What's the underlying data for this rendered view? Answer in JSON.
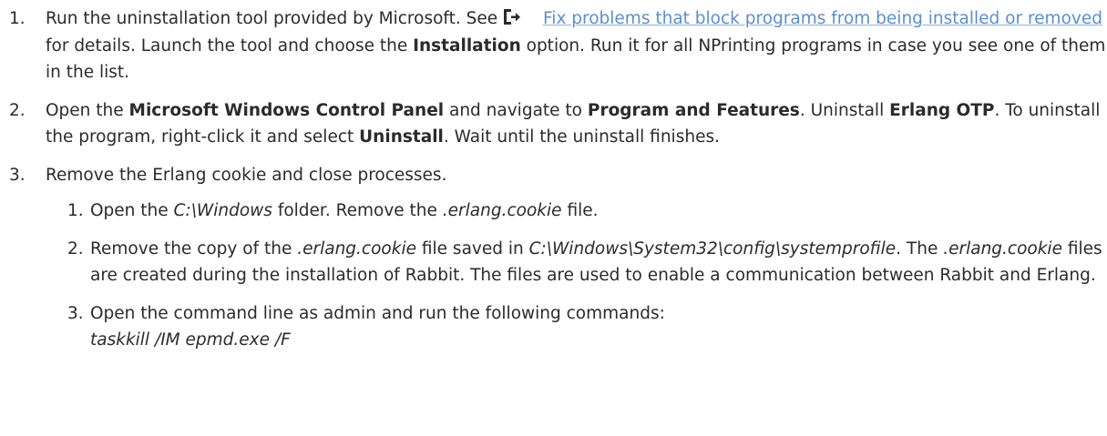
{
  "steps": [
    {
      "number": "1.",
      "pre_link": "Run the uninstallation tool provided by Microsoft. See",
      "icon": "external-link-icon",
      "link_text": "Fix problems that block programs from being installed or removed",
      "after_link": "for details. Launch the tool and choose the",
      "bold_1": "Installation",
      "tail": "option. Run it for all NPrinting programs in case you see one of them in the list."
    },
    {
      "number": "2.",
      "t1": "Open the",
      "b1": "Microsoft Windows Control Panel",
      "t2": "and navigate to",
      "b2": "Program and Features",
      "t3": ". Uninstall",
      "b3": "Erlang OTP",
      "t4": ". To uninstall the program, right-click it and select",
      "b4": "Uninstall",
      "t5": ". Wait until the uninstall finishes."
    },
    {
      "number": "3.",
      "text": "Remove the Erlang cookie and close processes.",
      "substeps": [
        {
          "number": "1.",
          "t1": "Open the",
          "i1": "C:\\Windows",
          "t2": "folder. Remove the",
          "i2": ".erlang.cookie",
          "t3": "file."
        },
        {
          "number": "2.",
          "t1": "Remove the copy of the",
          "i1": ".erlang.cookie",
          "t2": "file saved in",
          "i2": "C:\\Windows\\System32\\config\\systemprofile",
          "t3": ". The",
          "i3": ".erlang.cookie",
          "t4": "files are created during the installation of Rabbit. The files are used to enable a communication between Rabbit and Erlang."
        },
        {
          "number": "3.",
          "t1": "Open the command line as admin and run the following commands:",
          "command": "taskkill /IM epmd.exe /F"
        }
      ]
    }
  ],
  "colors": {
    "link": "#5a8fd0",
    "text": "#2b2b2b"
  }
}
